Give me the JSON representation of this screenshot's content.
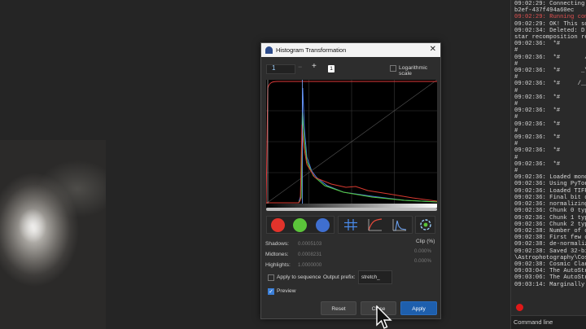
{
  "console": {
    "lines": [
      {
        "t": "09:02:29: Connecting to",
        "c": ""
      },
      {
        "t": "b2ef-437f494a60ec",
        "c": ""
      },
      {
        "t": "09:02:29: Running comma",
        "c": "red"
      },
      {
        "t": "09:02:29: OK! This scri",
        "c": ""
      },
      {
        "t": "09:02:34: Deleted: D:\\A",
        "c": ""
      },
      {
        "t": "star recomposition resu",
        "c": ""
      },
      {
        "t": "09:02:36:  *#         __",
        "c": ""
      },
      {
        "t": "#",
        "c": ""
      },
      {
        "t": "09:02:36:  *#       / _",
        "c": ""
      },
      {
        "t": "#",
        "c": ""
      },
      {
        "t": "09:02:36:  *#      _\\ \\",
        "c": ""
      },
      {
        "t": "#",
        "c": ""
      },
      {
        "t": "09:02:36:  *#     /___/",
        "c": ""
      },
      {
        "t": "#",
        "c": ""
      },
      {
        "t": "09:02:36:  *#",
        "c": ""
      },
      {
        "t": "#",
        "c": ""
      },
      {
        "t": "09:02:36:  *#",
        "c": ""
      },
      {
        "t": "#",
        "c": ""
      },
      {
        "t": "09:02:36:  *#",
        "c": ""
      },
      {
        "t": "#",
        "c": ""
      },
      {
        "t": "09:02:36:  *#",
        "c": ""
      },
      {
        "t": "#",
        "c": ""
      },
      {
        "t": "09:02:36:  *#",
        "c": ""
      },
      {
        "t": "#",
        "c": ""
      },
      {
        "t": "09:02:36:  *#",
        "c": ""
      },
      {
        "t": "#",
        "c": ""
      },
      {
        "t": "09:02:36: Loaded mono m",
        "c": ""
      },
      {
        "t": "09:02:36: Using PyTorch",
        "c": ""
      },
      {
        "t": "09:02:36: Loaded TIFF i",
        "c": ""
      },
      {
        "t": "09:02:36: Final bit dep",
        "c": ""
      },
      {
        "t": "09:02:36: normalizing l",
        "c": ""
      },
      {
        "t": "09:02:36: Chunk 0 type:",
        "c": ""
      },
      {
        "t": "09:02:36: Chunk 1 type:",
        "c": ""
      },
      {
        "t": "09:02:36: Chunk 2 type:",
        "c": ""
      },
      {
        "t": "09:02:38: Number of chu",
        "c": ""
      },
      {
        "t": "09:02:38: First few chu",
        "c": ""
      },
      {
        "t": "09:02:38: de-normalizin",
        "c": ""
      },
      {
        "t": "09:02:38: Saved 32-bit",
        "c": ""
      },
      {
        "t": "\\Astrophotography\\Cosmi",
        "c": ""
      },
      {
        "t": "09:02:38: Cosmic Clarit",
        "c": ""
      },
      {
        "t": "09:03:04: The AutoStret",
        "c": ""
      },
      {
        "t": "09:03:06: The AutoStret",
        "c": ""
      },
      {
        "t": "09:03:14: Marginally ou",
        "c": ""
      }
    ],
    "command_line_label": "Command line",
    "stop_color": "#e01818"
  },
  "dialog": {
    "title": "Histogram Transformation",
    "close_glyph": "✕",
    "zoom_value": "1",
    "zoom_minus": "−",
    "zoom_plus": "+",
    "zoom_badge": "1",
    "log_scale_label": "Logarithmic scale",
    "channels": [
      {
        "name": "red-channel-button",
        "color": "#e2332b"
      },
      {
        "name": "green-channel-button",
        "color": "#5bc43a"
      },
      {
        "name": "blue-channel-button",
        "color": "#3f6fd0"
      }
    ],
    "params": {
      "shadows_label": "Shadows:",
      "shadows_value": "0.0005103",
      "midtones_label": "Midtones:",
      "midtones_value": "0.0008231",
      "highlights_label": "Highlights:",
      "highlights_value": "1.0000000",
      "clip_label": "Clip (%)",
      "clip_low": "0.000%",
      "clip_high": "0.000%"
    },
    "apply_to_sequence_label": "Apply to sequence",
    "output_prefix_label": "Output prefix:",
    "output_prefix_value": "stretch_",
    "preview_label": "Preview",
    "reset_label": "Reset",
    "close_label": "Close",
    "apply_label": "Apply",
    "accent_color": "#1e5fad"
  }
}
